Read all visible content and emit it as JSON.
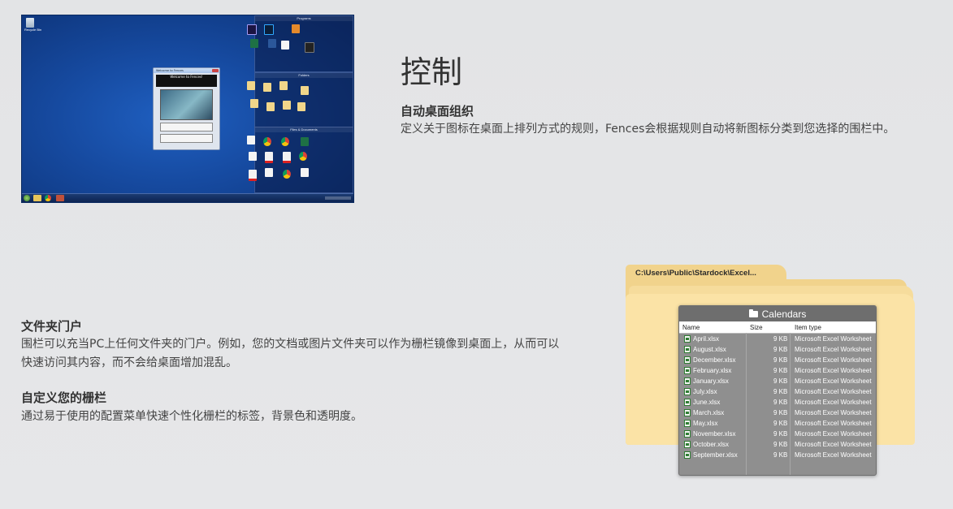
{
  "control": {
    "heading": "控制",
    "auto_org_title": "自动桌面组织",
    "auto_org_desc": "定义关于图标在桌面上排列方式的规则，Fences会根据规则自动将新图标分类到您选择的围栏中。",
    "folder_portal_title": "文件夹门户",
    "folder_portal_desc": "围栏可以充当PC上任何文件夹的门户。例如，您的文档或图片文件夹可以作为栅栏镜像到桌面上，从而可以快速访问其内容，而不会给桌面增加混乱。",
    "custom_title": "自定义您的栅栏",
    "custom_desc": "通过易于使用的配置菜单快速个性化栅栏的标签，背景色和透明度。"
  },
  "desktop_screenshot": {
    "recycle_bin": "Recycle Bin",
    "fence_programs": "Programs",
    "fence_folders": "Folders",
    "fence_files": "Files & Documents",
    "dialog_title": "Welcome to Fences",
    "dialog_header": "Welcome to Fences!"
  },
  "explorer": {
    "path": "C:\\Users\\Public\\Stardock\\Excel...",
    "folder_title": "Calendars",
    "columns": {
      "name": "Name",
      "size": "Size",
      "type": "Item type"
    },
    "files": [
      {
        "name": "April.xlsx",
        "size": "9 KB",
        "type": "Microsoft Excel Worksheet"
      },
      {
        "name": "August.xlsx",
        "size": "9 KB",
        "type": "Microsoft Excel Worksheet"
      },
      {
        "name": "December.xlsx",
        "size": "9 KB",
        "type": "Microsoft Excel Worksheet"
      },
      {
        "name": "February.xlsx",
        "size": "9 KB",
        "type": "Microsoft Excel Worksheet"
      },
      {
        "name": "January.xlsx",
        "size": "9 KB",
        "type": "Microsoft Excel Worksheet"
      },
      {
        "name": "July.xlsx",
        "size": "9 KB",
        "type": "Microsoft Excel Worksheet"
      },
      {
        "name": "June.xlsx",
        "size": "9 KB",
        "type": "Microsoft Excel Worksheet"
      },
      {
        "name": "March.xlsx",
        "size": "9 KB",
        "type": "Microsoft Excel Worksheet"
      },
      {
        "name": "May.xlsx",
        "size": "9 KB",
        "type": "Microsoft Excel Worksheet"
      },
      {
        "name": "November.xlsx",
        "size": "9 KB",
        "type": "Microsoft Excel Worksheet"
      },
      {
        "name": "October.xlsx",
        "size": "9 KB",
        "type": "Microsoft Excel Worksheet"
      },
      {
        "name": "September.xlsx",
        "size": "9 KB",
        "type": "Microsoft Excel Worksheet"
      }
    ]
  },
  "colors": {
    "folder_yellow": "#f1d38c",
    "panel_gray": "#8f8f8f",
    "desktop_blue": "#164aa0"
  }
}
